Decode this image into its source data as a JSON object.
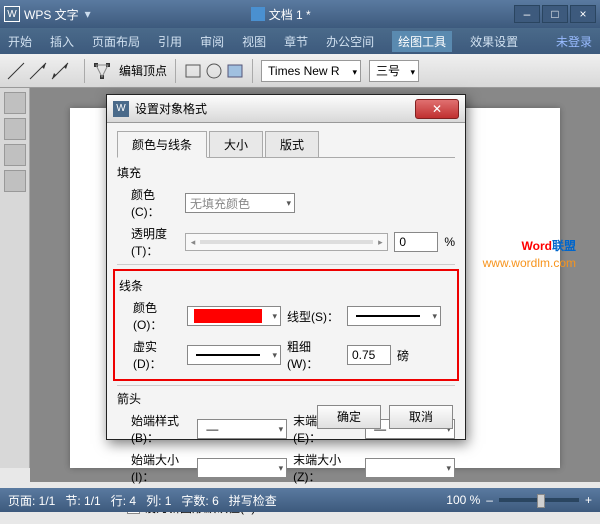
{
  "app": {
    "name": "WPS 文字",
    "doc": "文档 1 *"
  },
  "menu": {
    "items": [
      "开始",
      "插入",
      "页面布局",
      "引用",
      "审阅",
      "视图",
      "章节",
      "办公空间",
      "绘图工具",
      "效果设置",
      "未登录"
    ]
  },
  "ribbon": {
    "edit_vertex": "编辑顶点",
    "font": "Times New R",
    "size": "三号"
  },
  "dialog": {
    "title": "设置对象格式",
    "tabs": [
      "颜色与线条",
      "大小",
      "版式"
    ],
    "fill": {
      "group": "填充",
      "color_lbl": "颜色(C)：",
      "color_val": "无填充颜色",
      "trans_lbl": "透明度(T)：",
      "trans_val": "0",
      "trans_unit": "%"
    },
    "line": {
      "group": "线条",
      "color_lbl": "颜色(O)：",
      "style_lbl": "线型(S)：",
      "dash_lbl": "虚实(D)：",
      "weight_lbl": "粗细(W)：",
      "weight_val": "0.75",
      "weight_unit": "磅"
    },
    "arrow": {
      "group": "箭头",
      "bs_lbl": "始端样式(B)：",
      "es_lbl": "末端样式(E)：",
      "bsize_lbl": "始端大小(I)：",
      "esize_lbl": "末端大小(Z)："
    },
    "default_chk": "设为新图形默认值(F)",
    "ok": "确定",
    "cancel": "取消"
  },
  "status": {
    "page": "页面: 1/1",
    "sec": "节: 1/1",
    "line": "行: 4",
    "col": "列: 1",
    "chars": "字数: 6",
    "spell": "拼写检查",
    "zoom": "100 %"
  },
  "watermark": {
    "t1": "Word",
    "t2": "联盟",
    "url": "www.wordlm.com"
  }
}
